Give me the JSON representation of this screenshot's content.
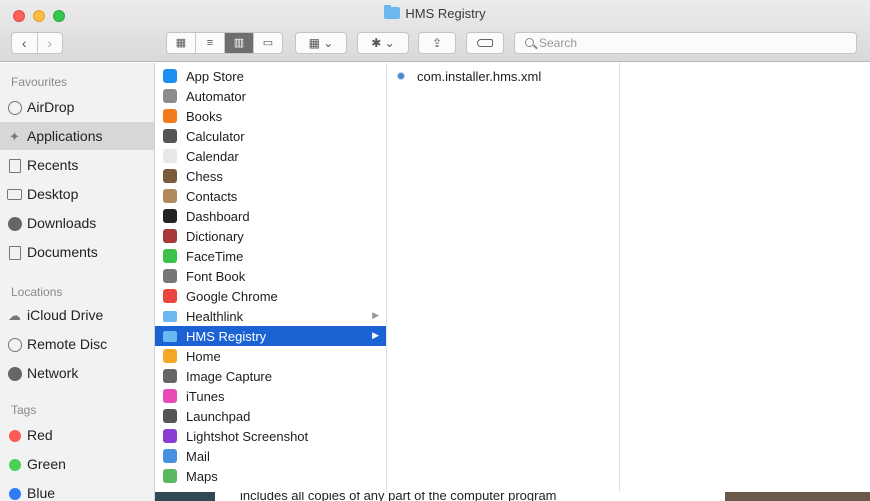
{
  "window": {
    "title": "HMS Registry"
  },
  "toolbar": {
    "back": "‹",
    "forward": "›",
    "view_icons": "▦",
    "view_list": "≡",
    "view_columns": "▥",
    "view_gallery": "▭",
    "arrange": "▦ ⌄",
    "action": "✱ ⌄",
    "share": "⇪",
    "search_placeholder": "Search"
  },
  "sidebar": {
    "favourites_heading": "Favourites",
    "favourites": [
      {
        "label": "AirDrop",
        "icon": "airdrop-icon"
      },
      {
        "label": "Applications",
        "icon": "applications-icon"
      },
      {
        "label": "Recents",
        "icon": "recents-icon"
      },
      {
        "label": "Desktop",
        "icon": "desktop-icon"
      },
      {
        "label": "Downloads",
        "icon": "downloads-icon"
      },
      {
        "label": "Documents",
        "icon": "documents-icon"
      }
    ],
    "locations_heading": "Locations",
    "locations": [
      {
        "label": "iCloud Drive",
        "icon": "cloud-icon"
      },
      {
        "label": "Remote Disc",
        "icon": "disc-icon"
      },
      {
        "label": "Network",
        "icon": "network-icon"
      }
    ],
    "tags_heading": "Tags",
    "tags": [
      {
        "label": "Red",
        "color": "#fc5a56"
      },
      {
        "label": "Green",
        "color": "#4bcf56"
      },
      {
        "label": "Blue",
        "color": "#2f7cf6"
      }
    ]
  },
  "column1": {
    "items": [
      {
        "label": "App Store",
        "color": "#1e8ff2"
      },
      {
        "label": "Automator",
        "color": "#8c8c8c"
      },
      {
        "label": "Books",
        "color": "#f27b1b"
      },
      {
        "label": "Calculator",
        "color": "#555555"
      },
      {
        "label": "Calendar",
        "color": "#e8e8e8"
      },
      {
        "label": "Chess",
        "color": "#7a5a3a"
      },
      {
        "label": "Contacts",
        "color": "#b08a5a"
      },
      {
        "label": "Dashboard",
        "color": "#222222"
      },
      {
        "label": "Dictionary",
        "color": "#a63a3a"
      },
      {
        "label": "FaceTime",
        "color": "#3cc24a"
      },
      {
        "label": "Font Book",
        "color": "#777777"
      },
      {
        "label": "Google Chrome",
        "color": "#e8453c"
      },
      {
        "label": "Healthlink",
        "color": "#6bb7f0",
        "folder": true
      },
      {
        "label": "HMS Registry",
        "color": "#6bb7f0",
        "folder": true,
        "selected": true
      },
      {
        "label": "Home",
        "color": "#f5a623"
      },
      {
        "label": "Image Capture",
        "color": "#666666"
      },
      {
        "label": "iTunes",
        "color": "#e84bb5"
      },
      {
        "label": "Launchpad",
        "color": "#555555"
      },
      {
        "label": "Lightshot Screenshot",
        "color": "#8a3fd0"
      },
      {
        "label": "Mail",
        "color": "#4a90e2"
      },
      {
        "label": "Maps",
        "color": "#5cb85c"
      }
    ]
  },
  "column2": {
    "items": [
      {
        "label": "com.installer.hms.xml"
      }
    ]
  },
  "background": {
    "text": "includes all copies of any part of the computer program"
  }
}
